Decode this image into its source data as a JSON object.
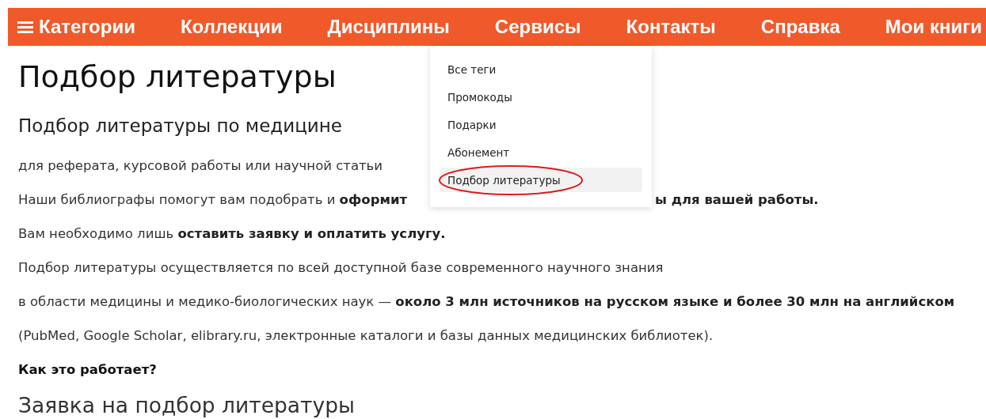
{
  "nav": {
    "items": [
      {
        "label": "Категории",
        "kind": "menu"
      },
      {
        "label": "Коллекции",
        "kind": "link"
      },
      {
        "label": "Дисциплины",
        "kind": "link"
      },
      {
        "label": "Сервисы",
        "kind": "link"
      },
      {
        "label": "Контакты",
        "kind": "link"
      },
      {
        "label": "Справка",
        "kind": "link"
      },
      {
        "label": "Мои книги",
        "kind": "link"
      }
    ]
  },
  "dropdown": {
    "items": [
      {
        "label": "Все теги",
        "selected": false,
        "circled": false
      },
      {
        "label": "Промокоды",
        "selected": false,
        "circled": false
      },
      {
        "label": "Подарки",
        "selected": false,
        "circled": false
      },
      {
        "label": "Абонемент",
        "selected": false,
        "circled": false
      },
      {
        "label": "Подбор литературы",
        "selected": true,
        "circled": true
      }
    ]
  },
  "page": {
    "title": "Подбор литературы",
    "subtitle": "Подбор литературы по медицине",
    "paragraphs": [
      {
        "kind": "text",
        "text": "для реферата, курсовой работы или научной статьи"
      },
      {
        "kind": "split",
        "left": "Наши библиографы помогут вам подобрать и **оформит**",
        "right": "**ы для вашей работы.**"
      },
      {
        "kind": "text",
        "text": "Вам необходимо лишь **оставить заявку и оплатить услугу.**"
      },
      {
        "kind": "text",
        "text": "Подбор литературы осуществляется по всей доступной базе современного научного знания"
      },
      {
        "kind": "text",
        "text": "в области медицины и медико-биологических наук — **около 3 млн источников на русском языке и более 30 млн на английском**"
      },
      {
        "kind": "text",
        "text": "(PubMed, Google Scholar, elibrary.ru, электронные каталоги и базы данных медицинских библиотек)."
      },
      {
        "kind": "bold",
        "text": "Как это работает?"
      }
    ],
    "section_heading": "Заявка на подбор литературы"
  }
}
